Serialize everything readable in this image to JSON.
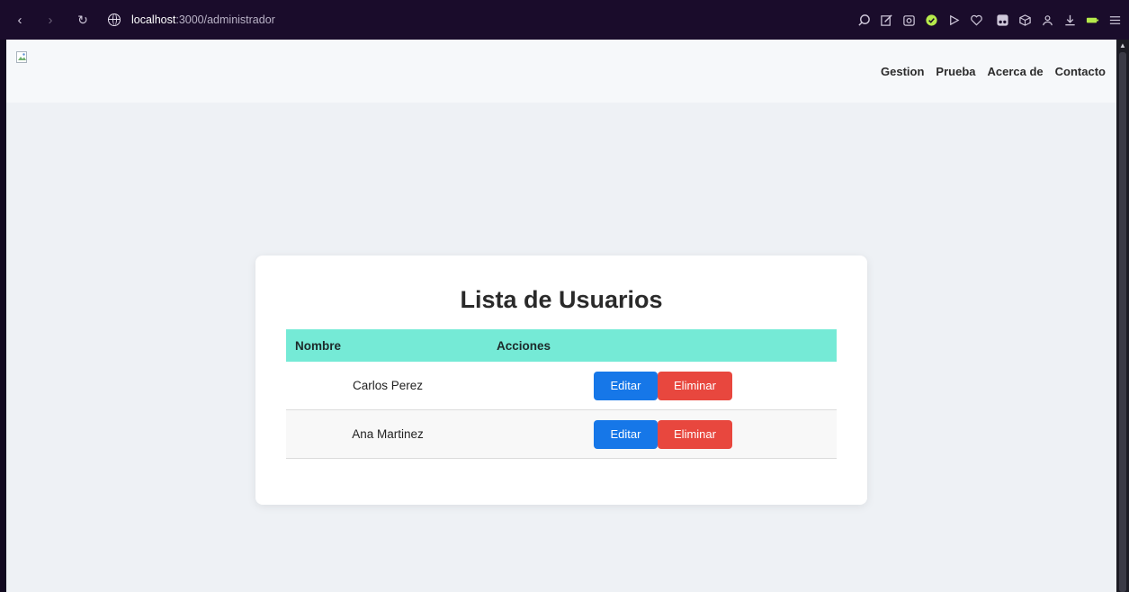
{
  "browser": {
    "url_host": "localhost",
    "url_path": ":3000/administrador"
  },
  "navbar": {
    "links": [
      "Gestion",
      "Prueba",
      "Acerca de",
      "Contacto"
    ]
  },
  "card": {
    "title": "Lista de Usuarios",
    "columns": [
      "Nombre",
      "Acciones"
    ],
    "rows": [
      {
        "name": "Carlos Perez",
        "edit_label": "Editar",
        "delete_label": "Eliminar"
      },
      {
        "name": "Ana Martinez",
        "edit_label": "Editar",
        "delete_label": "Eliminar"
      }
    ]
  },
  "colors": {
    "header_bg": "#75ead6",
    "edit_button": "#1677e8",
    "delete_button": "#e8473e"
  }
}
